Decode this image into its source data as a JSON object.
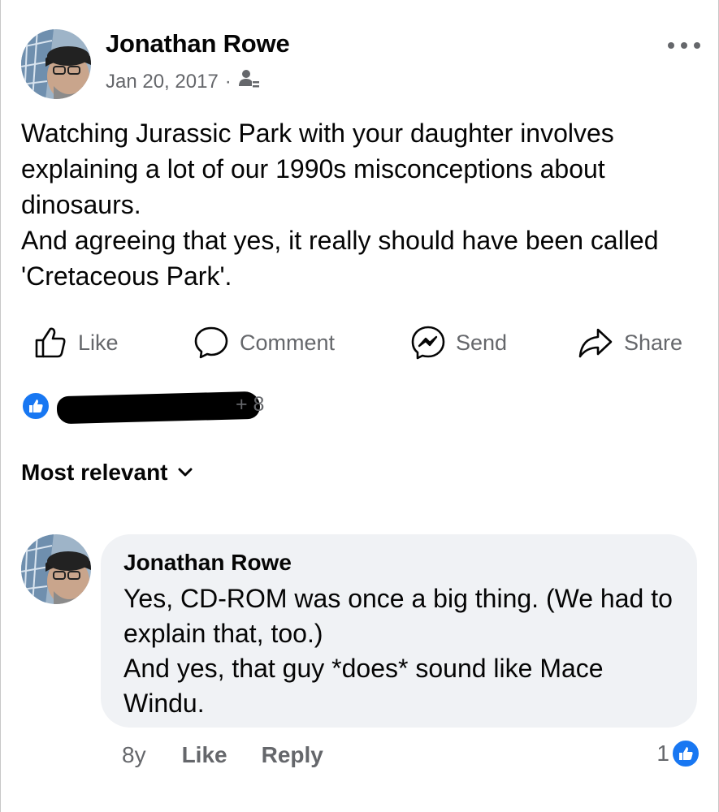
{
  "post": {
    "author": "Jonathan Rowe",
    "date": "Jan 20, 2017",
    "separator": "·",
    "audience_icon": "friends-audience-icon",
    "paragraphs": [
      "Watching Jurassic Park with your daughter involves explaining a lot of our 1990s misconceptions about dinosaurs.",
      "And agreeing that yes, it really should have been called 'Cretaceous Park'."
    ]
  },
  "actions": {
    "like": "Like",
    "comment": "Comment",
    "send": "Send",
    "share": "Share"
  },
  "reactions": {
    "others": "+ 8"
  },
  "sort": {
    "label": "Most relevant"
  },
  "comment": {
    "author": "Jonathan Rowe",
    "paragraphs": [
      "Yes, CD-ROM was once a big thing. (We had to explain that, too.)",
      "And yes, that guy *does* sound like Mace Windu."
    ],
    "time": "8y",
    "like": "Like",
    "reply": "Reply",
    "reaction_count": "1"
  },
  "colors": {
    "accent": "#1877f2",
    "secondary_text": "#65676b",
    "bubble": "#f0f2f5"
  }
}
